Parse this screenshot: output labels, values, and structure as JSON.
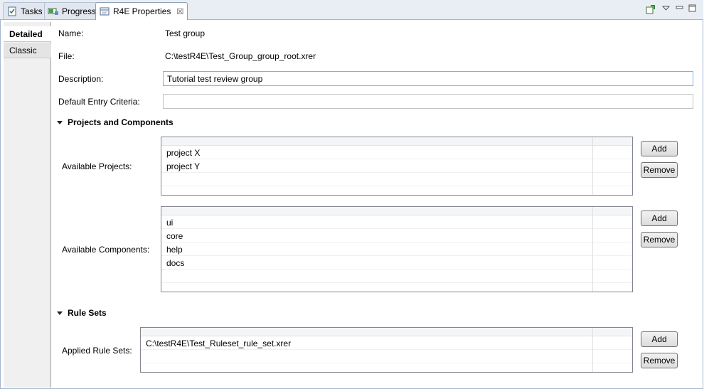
{
  "tabs": [
    {
      "label": "Tasks",
      "icon": "tasks-icon"
    },
    {
      "label": "Progress",
      "icon": "progress-icon"
    },
    {
      "label": "R4E Properties",
      "icon": "properties-icon"
    }
  ],
  "side_tabs": [
    {
      "label": "Detailed",
      "selected": true
    },
    {
      "label": "Classic",
      "selected": false
    }
  ],
  "fields": {
    "name": {
      "label": "Name:",
      "value": "Test group"
    },
    "file": {
      "label": "File:",
      "value": "C:\\testR4E\\Test_Group_group_root.xrer"
    },
    "description": {
      "label": "Description:",
      "value": "Tutorial test review group"
    },
    "entry_criteria": {
      "label": "Default Entry Criteria:",
      "value": ""
    }
  },
  "sections": {
    "projects_components": {
      "title": "Projects and Components",
      "available_projects": {
        "label": "Available Projects:",
        "items": [
          "project X",
          "project Y"
        ],
        "add_label": "Add",
        "remove_label": "Remove"
      },
      "available_components": {
        "label": "Available Components:",
        "items": [
          "ui",
          "core",
          "help",
          "docs"
        ],
        "add_label": "Add",
        "remove_label": "Remove"
      }
    },
    "rule_sets": {
      "title": "Rule Sets",
      "applied_rule_sets": {
        "label": "Applied Rule Sets:",
        "items": [
          "C:\\testR4E\\Test_Ruleset_rule_set.xrer"
        ],
        "add_label": "Add",
        "remove_label": "Remove"
      }
    }
  },
  "colors": {
    "tab_bar": "#e9edf4",
    "focus_border": "#7eb4ea"
  }
}
